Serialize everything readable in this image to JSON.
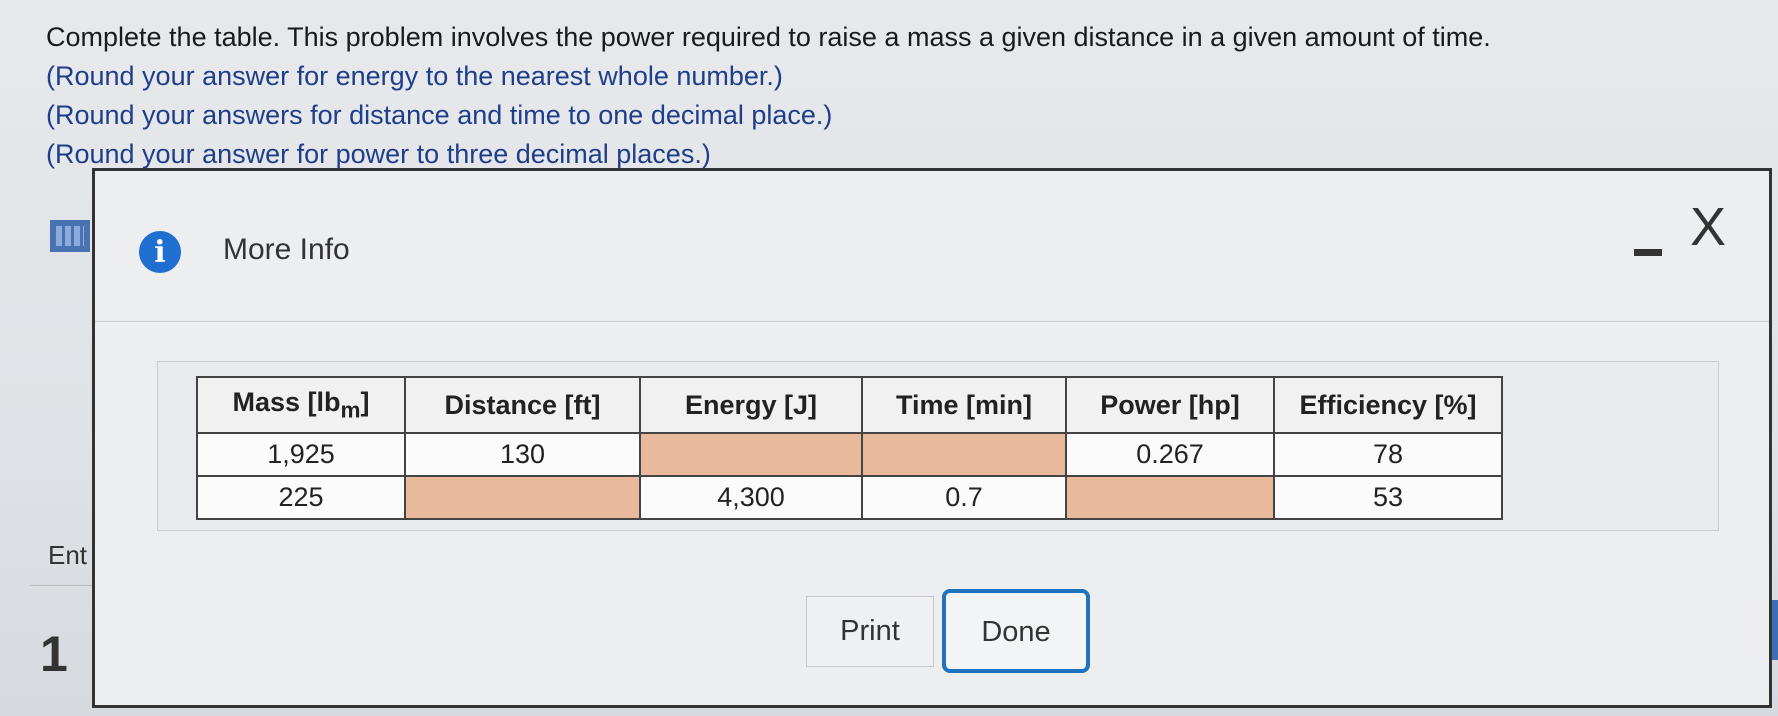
{
  "problem": {
    "line1": "Complete the table. This problem involves the power required to raise a mass a given distance in a given amount of time.",
    "line2": "(Round your answer for energy to the nearest whole number.)",
    "line3": "(Round your answers for distance and time to one decimal place.)",
    "line4": "(Round your answer for power to three decimal places.)"
  },
  "background": {
    "enter_partial": "Ent",
    "question_number": "1"
  },
  "dialog": {
    "title": "More Info",
    "info_icon": "info-icon",
    "minimize_icon": "minimize-icon",
    "close_glyph": "X",
    "table": {
      "headers": [
        "Mass [lb",
        "Distance [ft]",
        "Energy [J]",
        "Time [min]",
        "Power [hp]",
        "Efficiency [%]"
      ],
      "mass_subscript": "m",
      "rows": [
        [
          "1,925",
          "130",
          "",
          "",
          "0.267",
          "78"
        ],
        [
          "225",
          "",
          "4,300",
          "0.7",
          "",
          "53"
        ]
      ]
    },
    "buttons": {
      "print": "Print",
      "done": "Done"
    }
  },
  "colors": {
    "blank_cell": "#e8b99a",
    "accent": "#1e73be",
    "instruction_blue": "#1f3e8a"
  }
}
